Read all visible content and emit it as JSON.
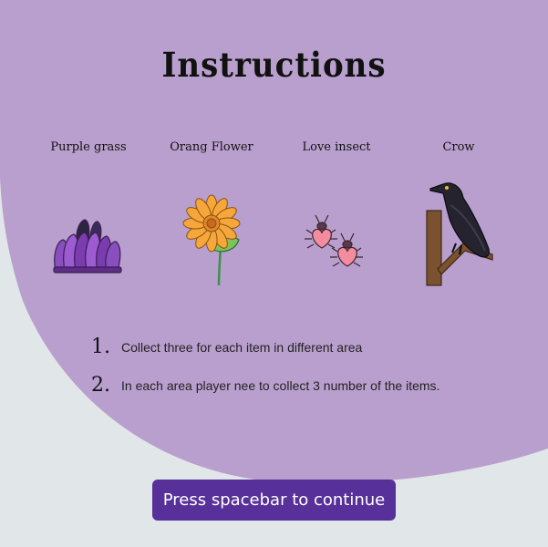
{
  "title": "Instructions",
  "items": [
    {
      "label": "Purple grass",
      "icon": "purple-grass-icon"
    },
    {
      "label": "Orang Flower",
      "icon": "orange-flower-icon"
    },
    {
      "label": "Love insect",
      "icon": "love-insect-icon"
    },
    {
      "label": "Crow",
      "icon": "crow-icon"
    }
  ],
  "steps": [
    {
      "number": "1.",
      "text": "Collect three for each item in different area"
    },
    {
      "number": "2.",
      "text": "In each area player nee to collect 3 number of the items."
    }
  ],
  "continue_label": "Press spacebar to continue",
  "colors": {
    "background": "#e1e7e9",
    "panel": "#b99fcd",
    "button": "#57309a",
    "button_text": "#ffffff"
  }
}
